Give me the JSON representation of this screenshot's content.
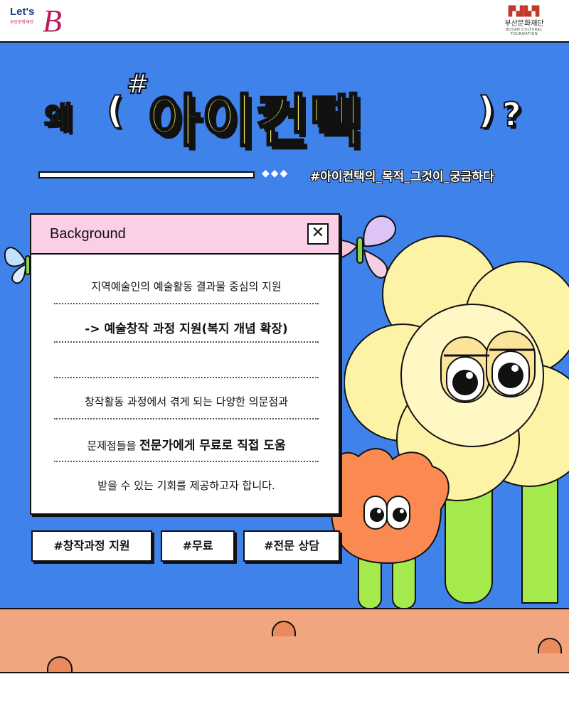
{
  "header": {
    "left_logo": {
      "word": "Let's",
      "sub": "부산문화재단",
      "letter": "B"
    },
    "right_logo": {
      "mark": "부산문화재단",
      "name": "부산문화재단",
      "english": "BUSAN CULTURAL FOUNDATION"
    }
  },
  "title": {
    "prefix": "왜",
    "open": "(",
    "hash": "#",
    "main": "아이컨택",
    "close": ")",
    "question": "?"
  },
  "tagline": {
    "diamonds": "◆◆◆",
    "text": "#아이컨택의_목적_그것이_궁금하다"
  },
  "window": {
    "title": "Background",
    "close_symbol": "✕",
    "lines": {
      "l1": "지역예술인의 예술활동 결과물 중심의 지원",
      "l2": "-> 예술창작 과정 지원(복지 개념 확장)",
      "l4": "창작활동 과정에서 겪게 되는 다양한 의문점과",
      "l5_pre": "문제점들을 ",
      "l5_bold": "전문가에게 무료로 직접 도움",
      "l6": "받을 수 있는 기회를 제공하고자 합니다."
    }
  },
  "tags": [
    "#창작과정 지원",
    "#무료",
    "#전문 상담"
  ],
  "colors": {
    "background": "#3f82ea",
    "accent_yellow": "#f6f56a",
    "window_header": "#fbcfe8",
    "ground": "#f2a67f"
  }
}
